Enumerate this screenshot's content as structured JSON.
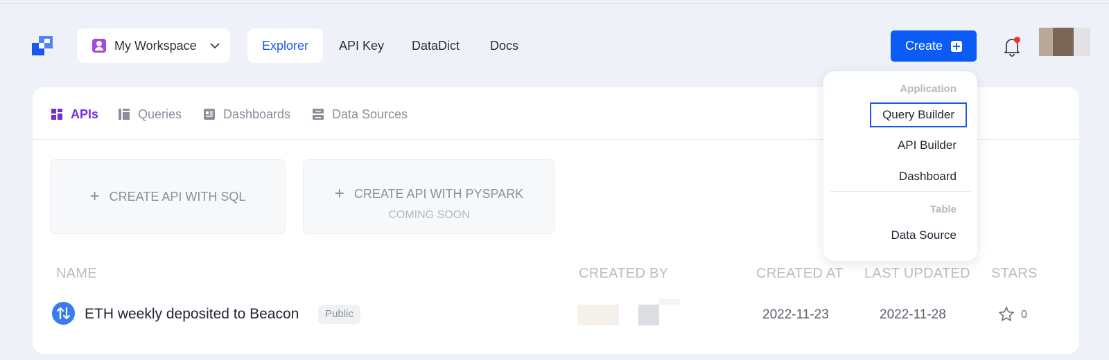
{
  "nav": {
    "workspace_label": "My Workspace",
    "links": [
      "Explorer",
      "API Key",
      "DataDict",
      "Docs"
    ],
    "active_link": "Explorer",
    "create_label": "Create",
    "has_notification": true
  },
  "tabs": [
    {
      "label": "APIs",
      "icon": "grid-icon",
      "active": true
    },
    {
      "label": "Queries",
      "icon": "columns-icon",
      "active": false
    },
    {
      "label": "Dashboards",
      "icon": "dashboard-icon",
      "active": false
    },
    {
      "label": "Data Sources",
      "icon": "database-icon",
      "active": false
    }
  ],
  "create_tiles": [
    {
      "label": "CREATE API WITH SQL",
      "sub": ""
    },
    {
      "label": "CREATE API WITH PYSPARK",
      "sub": "COMING SOON"
    }
  ],
  "table": {
    "columns": [
      "NAME",
      "CREATED BY",
      "CREATED AT",
      "LAST UPDATED",
      "STARS"
    ],
    "rows": [
      {
        "name": "ETH weekly deposited to Beacon",
        "visibility": "Public",
        "created_at": "2022-11-23",
        "last_updated": "2022-11-28",
        "stars": "0"
      }
    ]
  },
  "create_menu": {
    "groups": [
      {
        "label": "Application",
        "items": [
          "Query Builder",
          "API Builder",
          "Dashboard"
        ]
      },
      {
        "label": "Table",
        "items": [
          "Data Source"
        ]
      }
    ],
    "focused_item": "Query Builder"
  },
  "colors": {
    "accent": "#0a5cf5",
    "tab_active": "#7a2be0",
    "page_bg": "#eef1f8"
  }
}
